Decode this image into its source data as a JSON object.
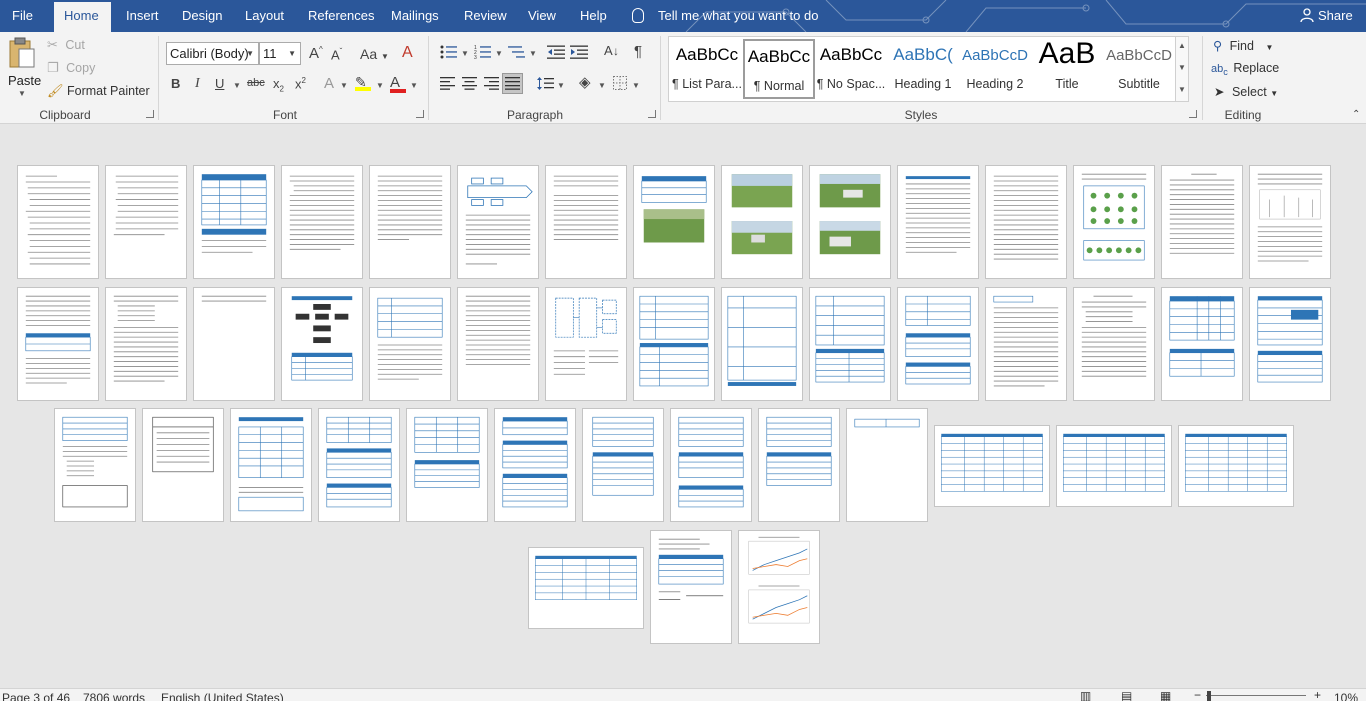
{
  "tabs": [
    "File",
    "Home",
    "Insert",
    "Design",
    "Layout",
    "References",
    "Mailings",
    "Review",
    "View",
    "Help"
  ],
  "active_tab": "Home",
  "tell_me": "Tell me what you want to do",
  "share": "Share",
  "clipboard": {
    "paste": "Paste",
    "cut": "Cut",
    "copy": "Copy",
    "format_painter": "Format Painter",
    "label": "Clipboard"
  },
  "font": {
    "name": "Calibri (Body)",
    "size": "11",
    "label": "Font"
  },
  "paragraph": {
    "label": "Paragraph"
  },
  "styles": {
    "label": "Styles",
    "items": [
      {
        "sample": "AaBbCc",
        "name": "¶ List Para..."
      },
      {
        "sample": "AaBbCc",
        "name": "¶ Normal"
      },
      {
        "sample": "AaBbCc",
        "name": "¶ No Spac..."
      },
      {
        "sample": "AaBbC(",
        "name": "Heading 1"
      },
      {
        "sample": "AaBbCcD",
        "name": "Heading 2"
      },
      {
        "sample": "AaB",
        "name": "Title"
      },
      {
        "sample": "AaBbCcD",
        "name": "Subtitle"
      }
    ]
  },
  "editing": {
    "find": "Find",
    "replace": "Replace",
    "select": "Select",
    "label": "Editing"
  },
  "status": {
    "page": "Page 3 of 46",
    "words": "7806 words",
    "language": "English (United States)",
    "zoom": "10%"
  },
  "colors": {
    "accent": "#2b579a",
    "table_blue": "#2e75b6"
  }
}
